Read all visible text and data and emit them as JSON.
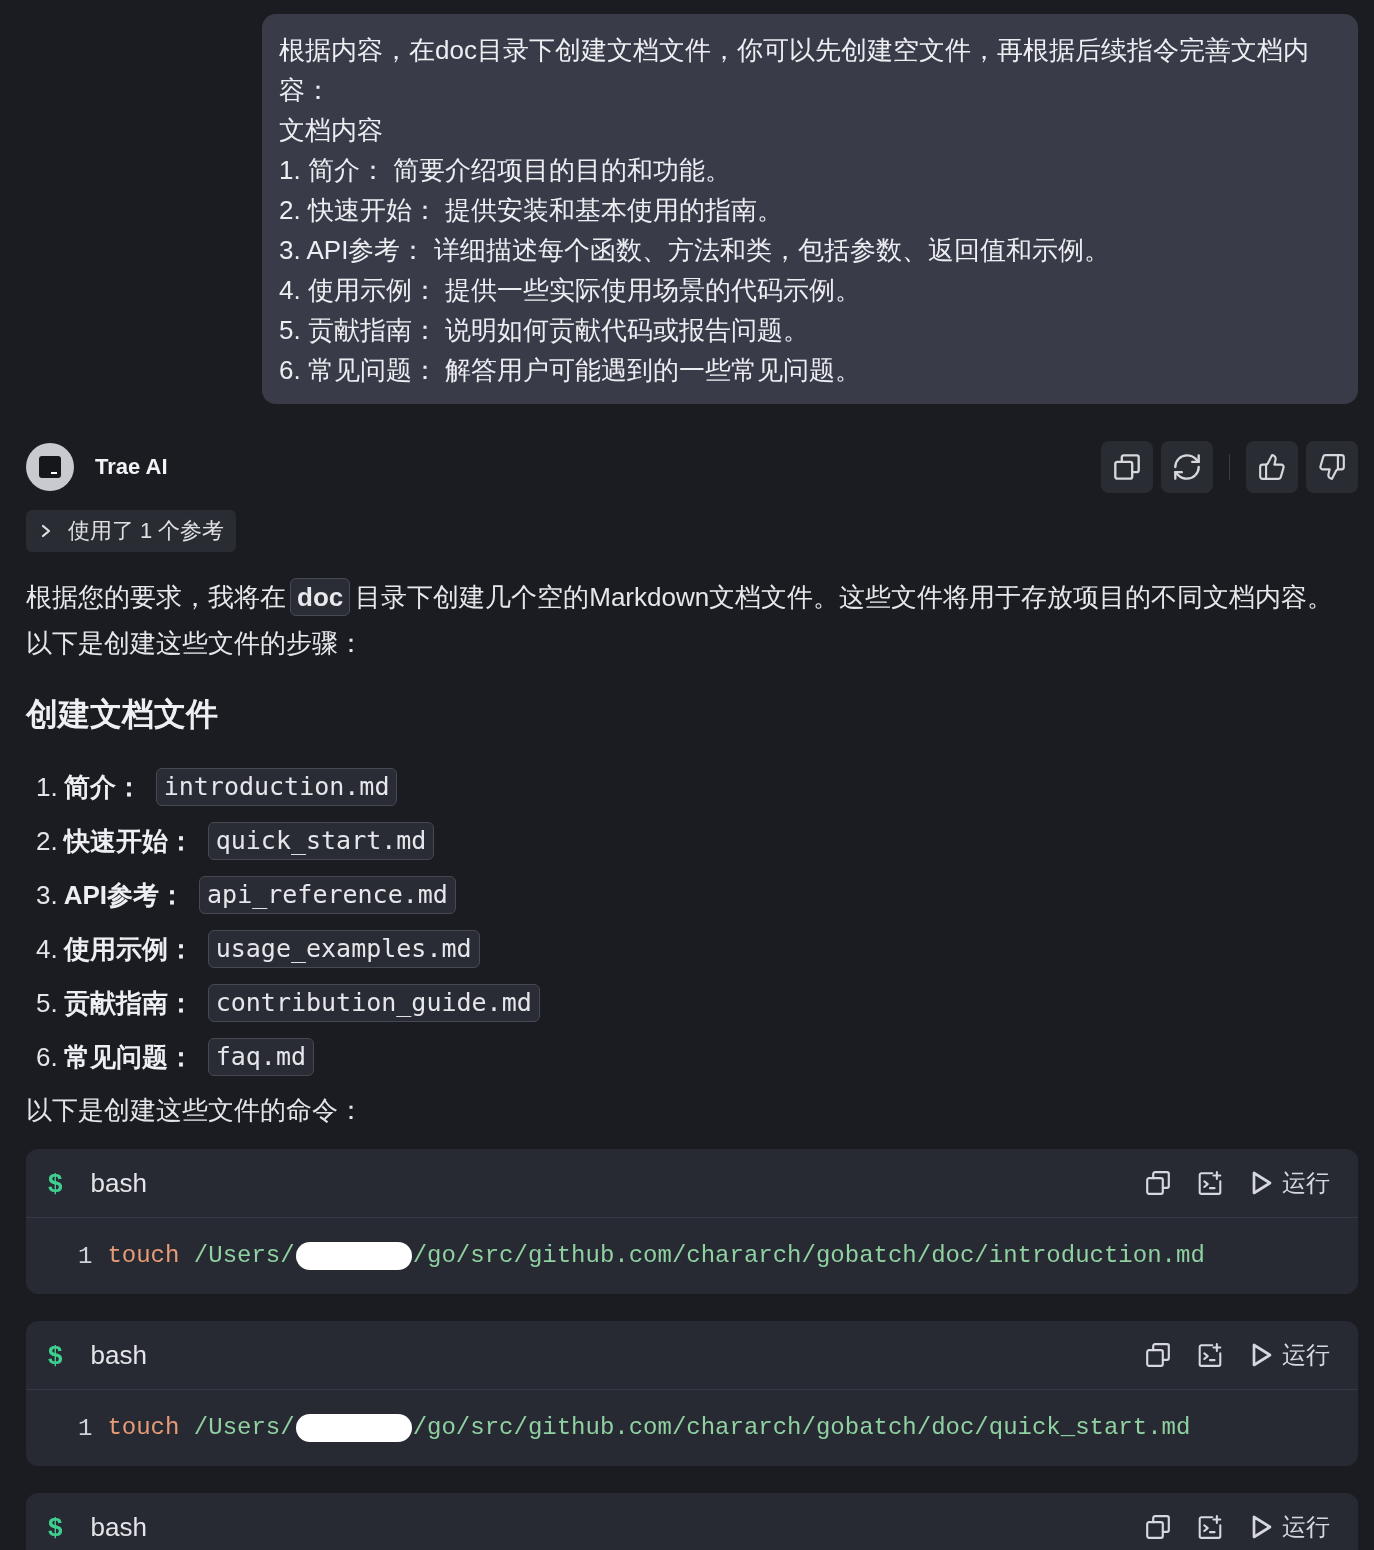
{
  "user_message": {
    "lines": [
      "根据内容，在doc目录下创建文档文件，你可以先创建空文件，再根据后续指令完善文档内容：",
      "文档内容",
      "1. 简介： 简要介绍项目的目的和功能。",
      "2. 快速开始： 提供安装和基本使用的指南。",
      "3. API参考： 详细描述每个函数、方法和类，包括参数、返回值和示例。",
      "4. 使用示例： 提供一些实际使用场景的代码示例。",
      "5. 贡献指南： 说明如何贡献代码或报告问题。",
      "6. 常见问题： 解答用户可能遇到的一些常见问题。"
    ]
  },
  "assistant": {
    "name": "Trae AI"
  },
  "reference": {
    "label": "使用了 1 个参考",
    "expanded": false
  },
  "response": {
    "intro": [
      {
        "kind": "text",
        "text": "根据您的要求，我将在"
      },
      {
        "kind": "code",
        "text": "doc"
      },
      {
        "kind": "text",
        "text": "目录下创建几个空的Markdown文档文件。这些文件将用于存放项目的不同文档内容。以下是创建这些文件的步骤："
      }
    ],
    "heading": "创建文档文件",
    "files": [
      {
        "number": "1.",
        "label": "简介：",
        "file": "introduction.md"
      },
      {
        "number": "2.",
        "label": "快速开始：",
        "file": "quick_start.md"
      },
      {
        "number": "3.",
        "label": "API参考：",
        "file": "api_reference.md"
      },
      {
        "number": "4.",
        "label": "使用示例：",
        "file": "usage_examples.md"
      },
      {
        "number": "5.",
        "label": "贡献指南：",
        "file": "contribution_guide.md"
      },
      {
        "number": "6.",
        "label": "常见问题：",
        "file": "faq.md"
      }
    ],
    "outro": "以下是创建这些文件的命令："
  },
  "code_blocks": [
    {
      "prompt": "$",
      "language": "bash",
      "run_label": "运行",
      "lines": [
        {
          "number": "1",
          "command": "touch",
          "path_start": "/Users/",
          "redacted": true,
          "path_end": "/go/src/github.com/chararch/gobatch/doc/introduction.md"
        }
      ]
    },
    {
      "prompt": "$",
      "language": "bash",
      "run_label": "运行",
      "lines": [
        {
          "number": "1",
          "command": "touch",
          "path_start": "/Users/",
          "redacted": true,
          "path_end": "/go/src/github.com/chararch/gobatch/doc/quick_start.md"
        }
      ]
    },
    {
      "prompt": "$",
      "language": "bash",
      "run_label": "运行"
    }
  ]
}
